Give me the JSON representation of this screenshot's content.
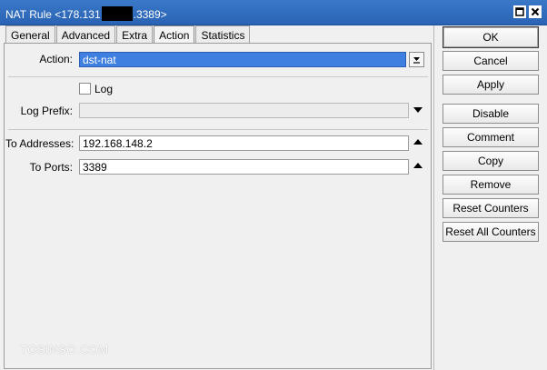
{
  "window": {
    "title_prefix": "NAT Rule <178.131",
    "title_suffix": ".3389>",
    "maximize_icon": "maximize-icon",
    "close_icon": "close-icon"
  },
  "tabs": [
    {
      "label": "General",
      "active": false
    },
    {
      "label": "Advanced",
      "active": false
    },
    {
      "label": "Extra",
      "active": false
    },
    {
      "label": "Action",
      "active": true
    },
    {
      "label": "Statistics",
      "active": false
    }
  ],
  "form": {
    "action_label": "Action:",
    "action_value": "dst-nat",
    "log_label": "Log",
    "log_checked": false,
    "log_prefix_label": "Log Prefix:",
    "log_prefix_value": "",
    "to_addresses_label": "To Addresses:",
    "to_addresses_value": "192.168.148.2",
    "to_ports_label": "To Ports:",
    "to_ports_value": "3389"
  },
  "buttons": {
    "ok": "OK",
    "cancel": "Cancel",
    "apply": "Apply",
    "disable": "Disable",
    "comment": "Comment",
    "copy": "Copy",
    "remove": "Remove",
    "reset_counters": "Reset Counters",
    "reset_all_counters": "Reset All Counters"
  },
  "watermark": "TOSINSO.COM",
  "colors": {
    "titlebar": "#2a63b4",
    "selection": "#3f7fe0",
    "background": "#f0f0f0"
  }
}
